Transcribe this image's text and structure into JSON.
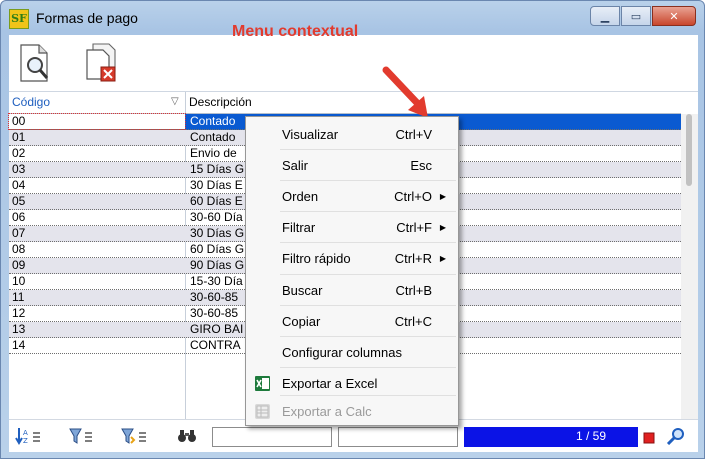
{
  "window": {
    "title": "Formas de pago",
    "app_icon_text": "SF"
  },
  "annotation": {
    "text": "Menu contextual",
    "color": "#e23b2e"
  },
  "grid": {
    "columns": [
      "Código",
      "Descripción"
    ],
    "rows": [
      {
        "code": "00",
        "desc": "Contado"
      },
      {
        "code": "01",
        "desc": "Contado"
      },
      {
        "code": "02",
        "desc": "Envio de"
      },
      {
        "code": "03",
        "desc": "15 Días G"
      },
      {
        "code": "04",
        "desc": "30 Días E"
      },
      {
        "code": "05",
        "desc": "60 Días E"
      },
      {
        "code": "06",
        "desc": "30-60 Día"
      },
      {
        "code": "07",
        "desc": "30 Días G"
      },
      {
        "code": "08",
        "desc": "60 Días G"
      },
      {
        "code": "09",
        "desc": "90 Días G"
      },
      {
        "code": "10",
        "desc": "15-30 Día"
      },
      {
        "code": "11",
        "desc": "30-60-85"
      },
      {
        "code": "12",
        "desc": "30-60-85"
      },
      {
        "code": "13",
        "desc": "GIRO BAI"
      },
      {
        "code": "14",
        "desc": "CONTRA"
      }
    ],
    "selected_index": 0
  },
  "context_menu": {
    "items": [
      {
        "label": "Visualizar",
        "shortcut": "Ctrl+V",
        "submenu": false,
        "enabled": true
      },
      {
        "label": "Salir",
        "shortcut": "Esc",
        "submenu": false,
        "enabled": true
      },
      {
        "label": "Orden",
        "shortcut": "Ctrl+O",
        "submenu": true,
        "enabled": true
      },
      {
        "label": "Filtrar",
        "shortcut": "Ctrl+F",
        "submenu": true,
        "enabled": true
      },
      {
        "label": "Filtro rápido",
        "shortcut": "Ctrl+R",
        "submenu": true,
        "enabled": true
      },
      {
        "label": "Buscar",
        "shortcut": "Ctrl+B",
        "submenu": false,
        "enabled": true
      },
      {
        "label": "Copiar",
        "shortcut": "Ctrl+C",
        "submenu": false,
        "enabled": true
      },
      {
        "label": "Configurar columnas",
        "shortcut": "",
        "submenu": false,
        "enabled": true
      },
      {
        "label": "Exportar a Excel",
        "shortcut": "",
        "submenu": false,
        "enabled": true,
        "icon": "excel-icon"
      },
      {
        "label": "Exportar a Calc",
        "shortcut": "",
        "submenu": false,
        "enabled": false,
        "icon": "calc-icon"
      }
    ]
  },
  "status": {
    "page_indicator": "1 / 59",
    "page_box_color": "#0b13e6"
  }
}
